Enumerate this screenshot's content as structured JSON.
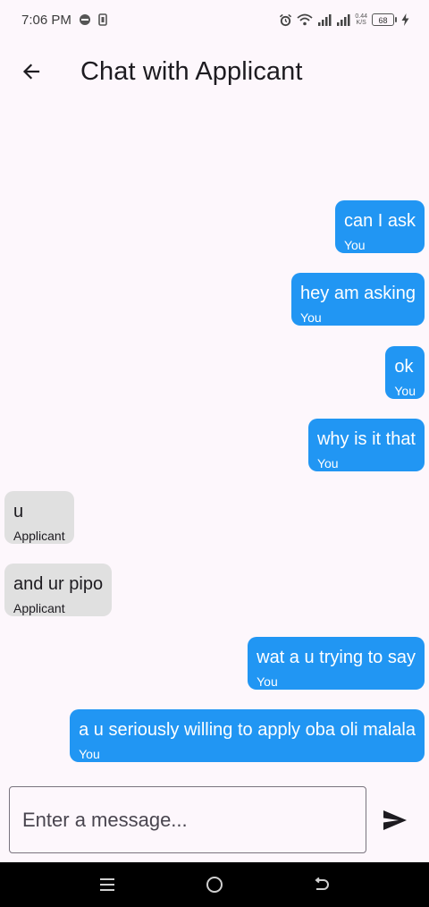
{
  "status_bar": {
    "time": "7:06 PM",
    "speed_top": "0.44",
    "speed_bottom": "K/S",
    "battery": "68"
  },
  "header": {
    "title": "Chat with Applicant"
  },
  "messages": [
    {
      "text": "can I ask",
      "sender": "You"
    },
    {
      "text": "hey am asking",
      "sender": "You"
    },
    {
      "text": "ok",
      "sender": "You"
    },
    {
      "text": "why is it that",
      "sender": "You"
    },
    {
      "text": "u",
      "sender": "Applicant"
    },
    {
      "text": "and ur pipo",
      "sender": "Applicant"
    },
    {
      "text": "wat a u trying to say",
      "sender": "You"
    },
    {
      "text": "a u seriously willing to apply oba oli malala",
      "sender": "You"
    }
  ],
  "composer": {
    "placeholder": "Enter a message...",
    "value": ""
  },
  "colors": {
    "background": "#fdf7fc",
    "my_bubble": "#2196f3",
    "their_bubble": "#e0e0e0",
    "nav_bar": "#000000"
  },
  "icons": {
    "back": "arrow-back-icon",
    "send": "send-icon",
    "nav_recents": "recents-icon",
    "nav_home": "home-icon",
    "nav_back": "nav-back-icon"
  }
}
